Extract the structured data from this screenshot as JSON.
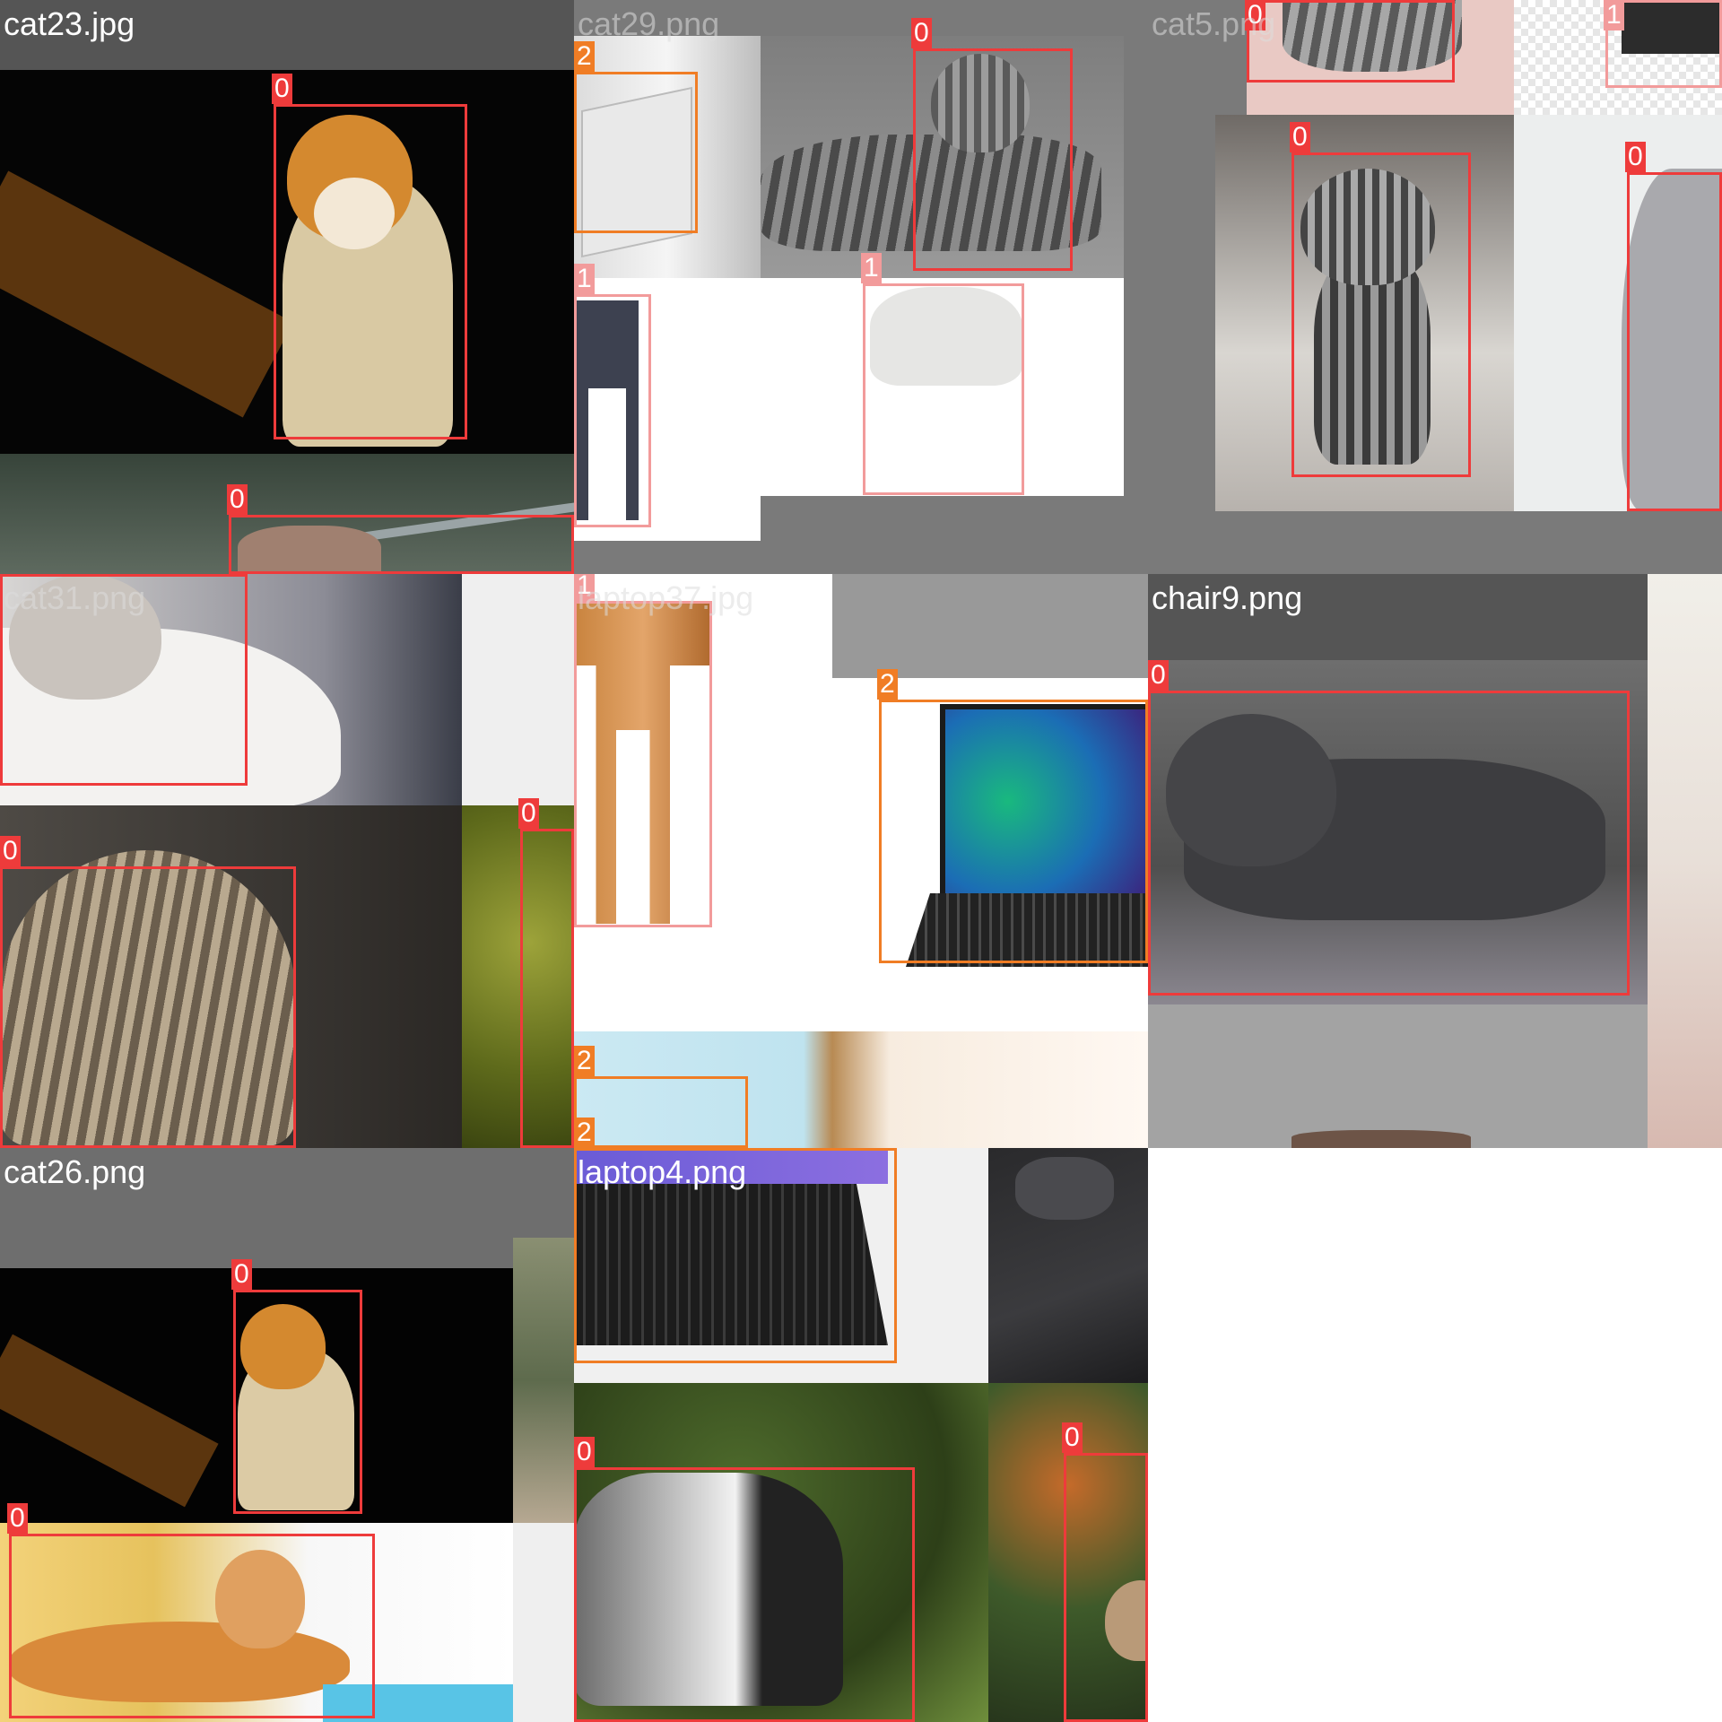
{
  "mosaic": {
    "tiles": [
      {
        "id": "t1",
        "label": "cat23.jpg"
      },
      {
        "id": "t2",
        "label": "cat29.png"
      },
      {
        "id": "t3",
        "label": "cat5.png"
      },
      {
        "id": "t4",
        "label": "cat31.png"
      },
      {
        "id": "t5",
        "label": "laptop37.jpg"
      },
      {
        "id": "t6",
        "label": "chair9.png"
      },
      {
        "id": "t7",
        "label": "cat26.png"
      },
      {
        "id": "t8",
        "label": "laptop4.png"
      }
    ],
    "box_tags": {
      "cat": "0",
      "chair": "1",
      "laptop": "2"
    },
    "class_colors": {
      "0": "#ee3b3b",
      "1": "#f29b9b",
      "2": "#f07d25"
    }
  }
}
